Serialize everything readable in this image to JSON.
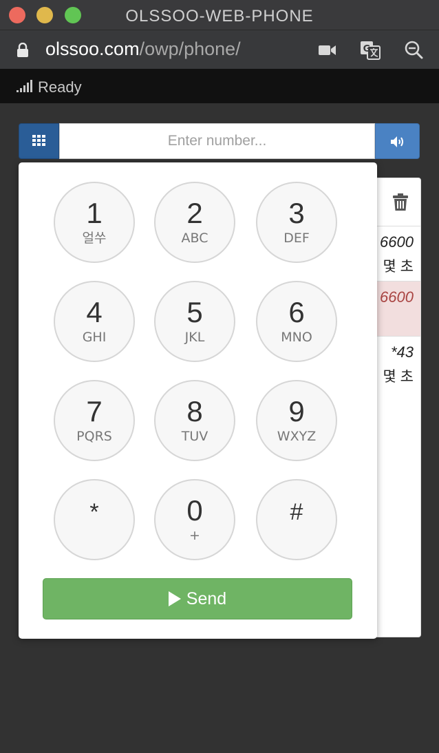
{
  "window": {
    "title": "OLSSOO-WEB-PHONE",
    "url_domain": "olssoo.com",
    "url_path": "/owp/phone/"
  },
  "status": {
    "text": "Ready",
    "icon": "signal-icon"
  },
  "number_entry": {
    "placeholder": "Enter number...",
    "value": ""
  },
  "history": {
    "rows": [
      {
        "number": "6600",
        "time": "몇 초"
      },
      {
        "number": "6600",
        "time": "",
        "highlight": true
      },
      {
        "number": "*43",
        "time": "몇 초"
      }
    ]
  },
  "dialpad": {
    "keys": [
      {
        "digit": "1",
        "letters": "얼쑤"
      },
      {
        "digit": "2",
        "letters": "ABC"
      },
      {
        "digit": "3",
        "letters": "DEF"
      },
      {
        "digit": "4",
        "letters": "GHI"
      },
      {
        "digit": "5",
        "letters": "JKL"
      },
      {
        "digit": "6",
        "letters": "MNO"
      },
      {
        "digit": "7",
        "letters": "PQRS"
      },
      {
        "digit": "8",
        "letters": "TUV"
      },
      {
        "digit": "9",
        "letters": "WXYZ"
      },
      {
        "digit": "*",
        "letters": ""
      },
      {
        "digit": "0",
        "letters": "+"
      },
      {
        "digit": "#",
        "letters": ""
      }
    ],
    "send_label": "Send"
  },
  "colors": {
    "background": "#323232",
    "keypad_toggle": "#2a5d97",
    "speaker_button": "#4a82c3",
    "send_button": "#6fb464",
    "highlight_row": "#f2dede"
  }
}
